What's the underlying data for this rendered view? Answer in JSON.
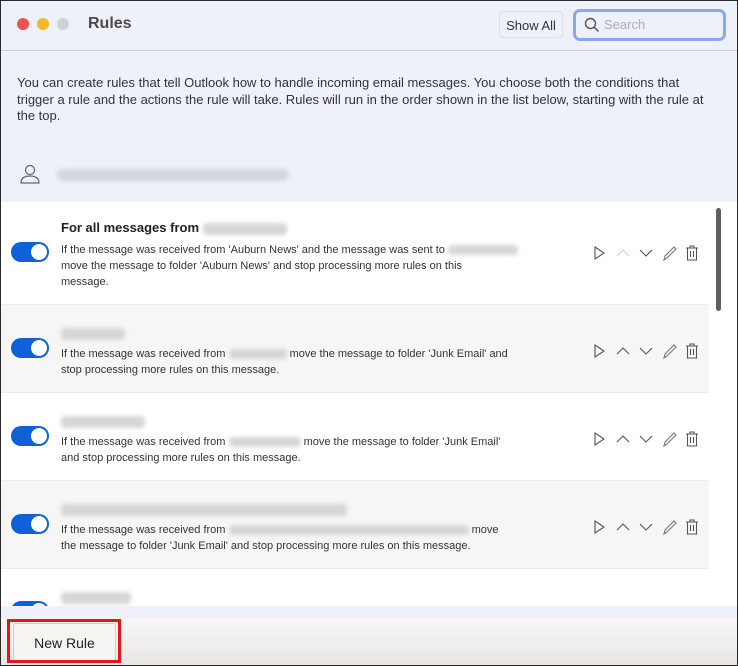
{
  "window": {
    "title": "Rules",
    "show_all_label": "Show All",
    "search_placeholder": "Search"
  },
  "description": "You can create rules that tell Outlook how to handle incoming email messages. You choose both the conditions that trigger a rule and the actions the rule will take. Rules will run in the order shown in the list below, starting with the rule at the top.",
  "account": {
    "icon": "person-icon",
    "email_redacted": true
  },
  "rules": [
    {
      "enabled": true,
      "name": "For all messages from",
      "name_redacted_suffix": true,
      "line1": "If the message was received from 'Auburn News' and the message was sent to",
      "line2": "move the message to folder 'Auburn News' and stop processing more rules on this",
      "line3": "message.",
      "move_up_enabled": false
    },
    {
      "enabled": true,
      "name": "",
      "name_redacted": true,
      "line1a": "If the message was received from",
      "line1b": "move the message to folder 'Junk Email' and",
      "line2": "stop processing more rules on this message.",
      "move_up_enabled": true
    },
    {
      "enabled": true,
      "name": "",
      "name_redacted": true,
      "line1a": "If the message was received from",
      "line1b": "move the message to folder 'Junk Email'",
      "line2": "and stop processing more rules on this message.",
      "move_up_enabled": true
    },
    {
      "enabled": true,
      "name": "",
      "name_redacted": true,
      "line1a": "If the message was received from",
      "line1b": "move",
      "line2": "the message to folder 'Junk Email' and stop processing more rules on this message.",
      "move_up_enabled": true
    },
    {
      "enabled": true,
      "name": "",
      "name_redacted": true
    }
  ],
  "rule_actions": [
    "run-icon",
    "move-up-icon",
    "move-down-icon",
    "edit-icon",
    "delete-icon"
  ],
  "footer": {
    "new_rule_label": "New Rule"
  },
  "colors": {
    "toggle_on": "#1060d8",
    "highlight": "#e8141b",
    "search_focus": "#8aa8ee"
  }
}
